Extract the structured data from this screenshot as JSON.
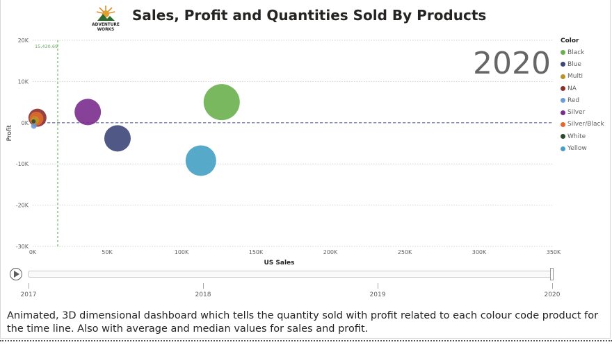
{
  "header": {
    "title": "Sales, Profit and Quantities Sold By Products",
    "logo_text_top": "ADVENTURE",
    "logo_text_bottom": "WORKS"
  },
  "year_label": "2020",
  "chart_data": {
    "type": "scatter",
    "title": "Sales, Profit and Quantities Sold By Products",
    "xlabel": "US Sales",
    "ylabel": "Profit",
    "xlim": [
      0,
      350000
    ],
    "ylim": [
      -30000,
      20000
    ],
    "x_ticks": [
      "0K",
      "50K",
      "100K",
      "150K",
      "200K",
      "250K",
      "300K",
      "350K"
    ],
    "x_tick_values": [
      0,
      50000,
      100000,
      150000,
      200000,
      250000,
      300000,
      350000
    ],
    "y_ticks": [
      "20K",
      "10K",
      "0K",
      "-10K",
      "-20K",
      "-30K"
    ],
    "y_tick_values": [
      20000,
      10000,
      0,
      -10000,
      -20000,
      -30000
    ],
    "grid": true,
    "legend_title": "Color",
    "legend_position": "right",
    "reference_lines": {
      "x_value": 15430.69,
      "x_label": "15,430.69",
      "x_color": "#8fc98a",
      "y_value": 0,
      "y_color": "#8a8fb5"
    },
    "series": [
      {
        "name": "Black",
        "color": "#6bb04f",
        "x": 127000,
        "y": 5000,
        "size": 13
      },
      {
        "name": "Blue",
        "color": "#3d4678",
        "x": 57000,
        "y": -3800,
        "size": 9.5
      },
      {
        "name": "Multi",
        "color": "#b8922c",
        "x": 1500,
        "y": 600,
        "size": 3
      },
      {
        "name": "NA",
        "color": "#8a2d2d",
        "x": 3200,
        "y": 1200,
        "size": 6.5
      },
      {
        "name": "Red",
        "color": "#6f9ad6",
        "x": 800,
        "y": -800,
        "size": 2
      },
      {
        "name": "Silver",
        "color": "#7a2c8e",
        "x": 37000,
        "y": 2600,
        "size": 9.5
      },
      {
        "name": "Silver/Black",
        "color": "#e06a2c",
        "x": 2500,
        "y": 1000,
        "size": 5
      },
      {
        "name": "White",
        "color": "#2b4a2b",
        "x": 600,
        "y": 300,
        "size": 1.5
      },
      {
        "name": "Yellow",
        "color": "#45a0c4",
        "x": 113000,
        "y": -9200,
        "size": 11
      }
    ]
  },
  "timeline": {
    "ticks": [
      "2017",
      "2018",
      "2019",
      "2020"
    ],
    "current": 1.0
  },
  "description": "Animated, 3D dimensional dashboard which tells the quantity sold with profit related to each colour code product for the time line. Also with average and median values for sales and profit."
}
